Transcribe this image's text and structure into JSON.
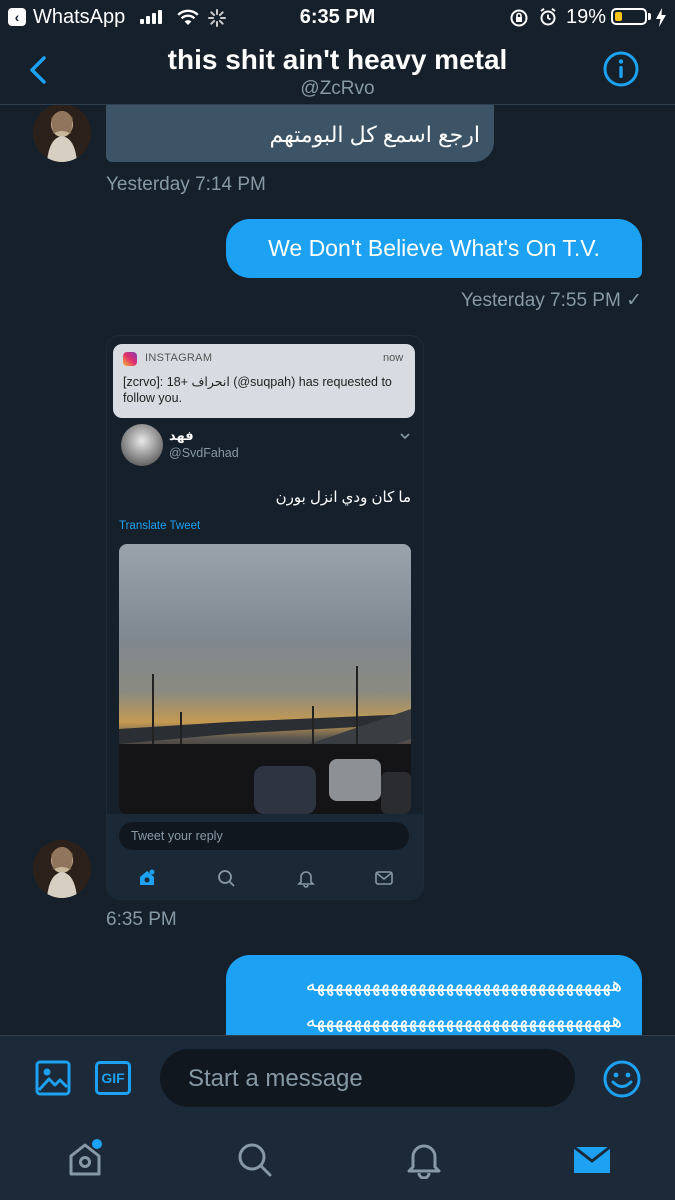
{
  "status_bar": {
    "back_app": "WhatsApp",
    "time": "6:35 PM",
    "battery": "19%"
  },
  "header": {
    "title": "this shit ain't heavy metal",
    "handle": "@ZcRvo"
  },
  "messages": {
    "incoming_1_text": "ارجع اسمع كل البومتهم",
    "incoming_1_time": "Yesterday 7:14 PM",
    "outgoing_1_text": "We Don't Believe What's On T.V.",
    "outgoing_1_time": "Yesterday 7:55 PM ✓",
    "incoming_2_time": "6:35 PM",
    "outgoing_2_line1": "هههههههههههههههههههههههههههههههههه",
    "outgoing_2_line2": "هههههههههههههههههههههههههههههههههه"
  },
  "embed": {
    "notif_app": "INSTAGRAM",
    "notif_time": "now",
    "notif_body": "[zcrvo]: انحراف +18 (@suqpah) has requested to follow you.",
    "tweet_name": "فهد",
    "tweet_handle": "@SvdFahad",
    "tweet_text": "ما كان ودي انزل بورن",
    "translate": "Translate Tweet",
    "reply_placeholder": "Tweet your reply"
  },
  "composer": {
    "placeholder": "Start a message",
    "gif_label": "GIF"
  },
  "icons": {
    "image": "image-icon",
    "gif": "gif-icon",
    "emoji": "emoji-icon",
    "home": "home-icon",
    "search": "search-icon",
    "notifications": "bell-icon",
    "messages": "mail-icon"
  },
  "colors": {
    "background": "#15202b",
    "accent": "#1da1f2",
    "incoming_bubble": "#3d5466",
    "muted_text": "#8899a6"
  }
}
